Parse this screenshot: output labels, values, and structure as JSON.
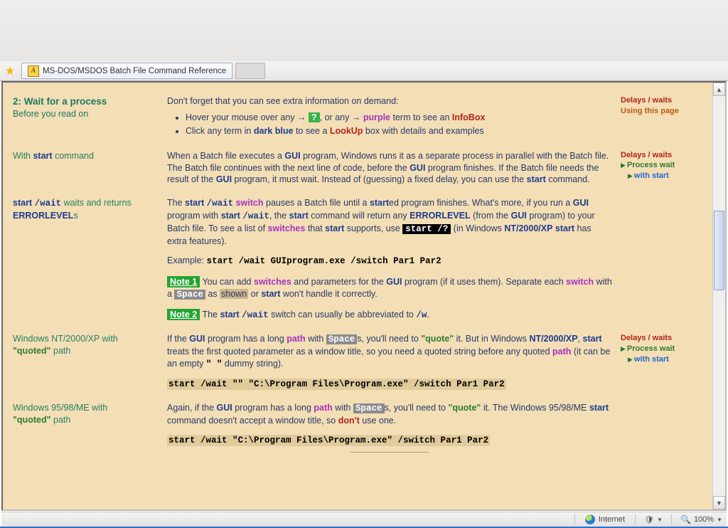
{
  "tab": {
    "title": "MS-DOS/MSDOS Batch File Command Reference",
    "favicon_letter": "A"
  },
  "toolbar_icons": [
    "home",
    "rss",
    "mail",
    "print",
    "page",
    "tools",
    "gear",
    "help"
  ],
  "sidebar": {
    "sec1": {
      "head": "Delays / waits",
      "link": "Using this page"
    },
    "sec2": {
      "head": "Delays / waits",
      "l1": "Process wait",
      "l2": "with start"
    },
    "sec3": {
      "head": "Delays / waits",
      "l1": "Process wait",
      "l2": "with start"
    }
  },
  "s1": {
    "title": "2: Wait for a process",
    "sub": "Before you read on",
    "intro": "Don't forget that you can see extra information on demand:",
    "b1a": "Hover your mouse over any",
    "b1b": ", or any",
    "b1c": "term to see an",
    "infobox": "InfoBox",
    "purple": "purple",
    "qmark": "?",
    "b2a": "Click any term in",
    "darkblue": "dark blue",
    "b2b": "to see a",
    "lookup": "LookUp",
    "b2c": "box with details and examples"
  },
  "s2": {
    "left_a": "With",
    "left_b": "command",
    "start": "start",
    "t1": "When a Batch file executes a",
    "gui": "GUI",
    "t2": "program, Windows runs it as a separate process in parallel with the Batch file. The Batch file continues with the next line of code, before the",
    "t3": "program finishes. If the Batch file needs the result of the",
    "t4": "program, it must wait. Instead of (guessing) a fixed delay, you can use the",
    "t5": "command."
  },
  "s3": {
    "left_a": "start",
    "left_b": "waits and returns",
    "left_c": "ERRORLEVEL",
    "left_s": "s",
    "wait": "/wait",
    "switch": "switch",
    "start": "start",
    "started": "start",
    "t1": "The",
    "t2": "pauses a Batch file until a",
    "t2b": "ed program finishes. What's more, if you run a",
    "gui": "GUI",
    "t3": "program with",
    "t4": ", the",
    "t5": "command will return any",
    "err": "ERRORLEVEL",
    "t6": "(from the",
    "t7": "program) to your Batch file. To see a list of",
    "switches": "switches",
    "t8": "that",
    "t9": "supports, use",
    "cmd": "start /?",
    "t10": "(in Windows",
    "nt": "NT/2000/XP",
    "t11": "has extra features).",
    "ex_label": "Example:",
    "ex_cmd": "start /wait GUIprogram.exe /switch Par1 Par2",
    "n1": "Note 1",
    "n1a": "You can add",
    "n1b": "and parameters for the",
    "n1c": "program (if it uses them). Separate each",
    "n1d": "with a",
    "space": "Space",
    "n1e": "as",
    "shown": "shown",
    "n1f": "or",
    "n1g": "won't handle it correctly.",
    "n2": "Note 2",
    "n2a": "The",
    "n2b": "switch can usually be abbreviated to",
    "n2c": "/w"
  },
  "s4": {
    "left_a": "Windows NT/2000/XP with",
    "left_q": "\"quoted\"",
    "left_b": "path",
    "t1": "If the",
    "gui": "GUI",
    "t2": "program has a long",
    "path": "path",
    "t3": "with",
    "space": "Space",
    "t4": "s, you'll need to",
    "quote": "\"quote\"",
    "t5": "it. But in Windows",
    "nt": "NT/2000/XP",
    "t5b": ",",
    "start": "start",
    "t6": "treats the first quoted parameter as a window title, so you need a quoted string before any quoted",
    "t7": "(it can be an empty",
    "empty": "\" \"",
    "t8": "dummy string).",
    "cmd": "start /wait \"\" \"C:\\Program Files\\Program.exe\" /switch Par1 Par2"
  },
  "s5": {
    "left_a": "Windows 95/98/ME with",
    "left_q": "\"quoted\"",
    "left_b": "path",
    "t1": "Again, if the",
    "gui": "GUI",
    "t2": "program has a long",
    "path": "path",
    "t3": "with",
    "space": "Space",
    "t4": "s, you'll need to",
    "quote": "\"quote\"",
    "t5": "it. The Windows 95/98/ME",
    "start": "start",
    "t6": "command doesn't accept a window title, so",
    "dont": "don't",
    "t7": "use one.",
    "cmd": "start /wait \"C:\\Program Files\\Program.exe\" /switch Par1 Par2"
  },
  "status": {
    "zone": "Internet",
    "zoom": "100%"
  }
}
